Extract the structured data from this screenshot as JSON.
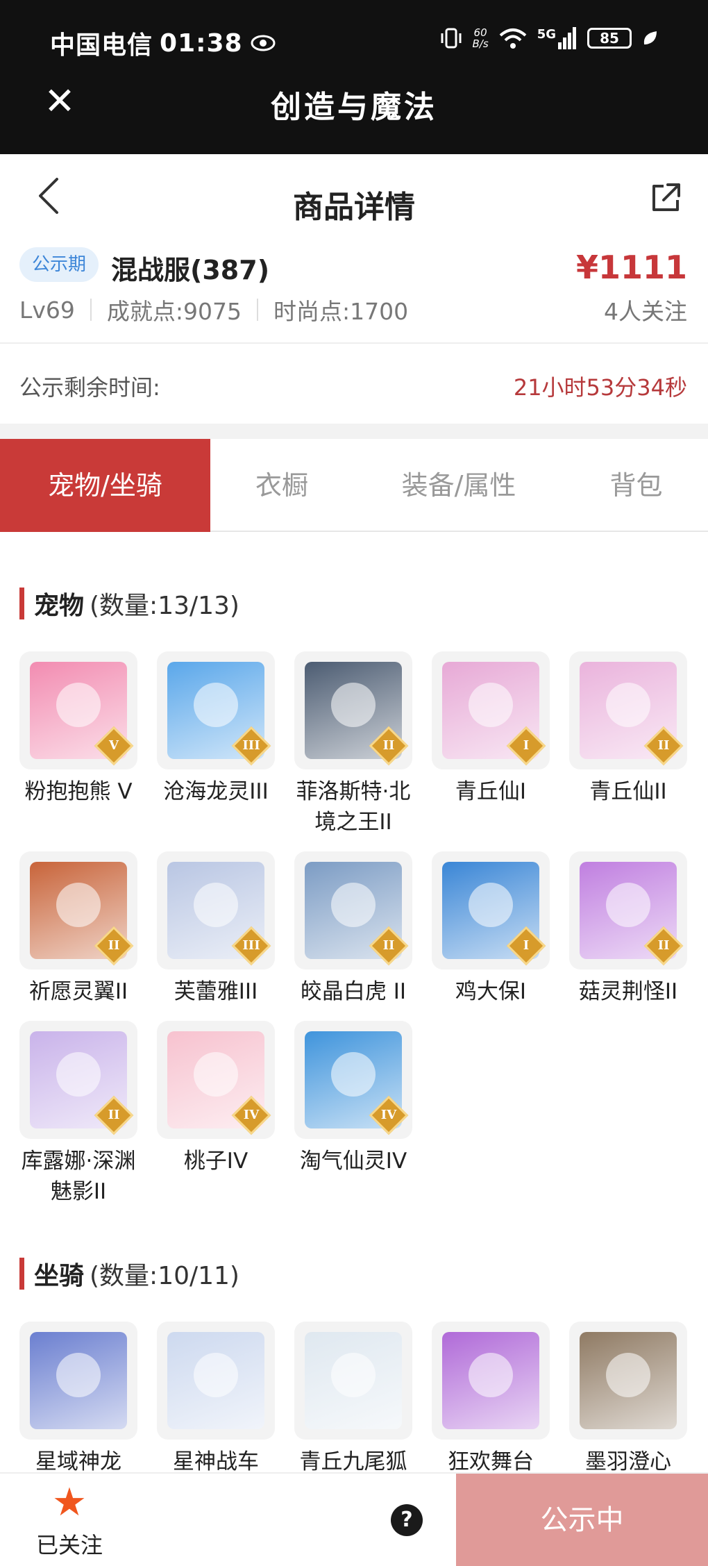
{
  "status_bar": {
    "carrier": "中国电信",
    "time": "01:38",
    "net_speed": "60",
    "net_unit": "B/s",
    "network": "5G",
    "battery": "85"
  },
  "app": {
    "title": "创造与魔法"
  },
  "page": {
    "title": "商品详情"
  },
  "item": {
    "badge": "公示期",
    "server": "混战服(387)",
    "price": "¥1111",
    "level": "Lv69",
    "achievement": "成就点:9075",
    "fashion": "时尚点:1700",
    "followers": "4人关注",
    "timer_label": "公示剩余时间:",
    "timer_value": "21小时53分34秒"
  },
  "tabs": [
    {
      "label": "宠物/坐骑",
      "active": true
    },
    {
      "label": "衣橱",
      "active": false
    },
    {
      "label": "装备/属性",
      "active": false
    },
    {
      "label": "背包",
      "active": false
    }
  ],
  "pets": {
    "title": "宠物",
    "count": "(数量:13/13)",
    "items": [
      {
        "name": "粉抱抱熊 V",
        "tier": "V",
        "color": "#f28cb1"
      },
      {
        "name": "沧海龙灵III",
        "tier": "III",
        "color": "#5aa7ea"
      },
      {
        "name": "菲洛斯特·北境之王II",
        "tier": "II",
        "color": "#4c5c72"
      },
      {
        "name": "青丘仙I",
        "tier": "I",
        "color": "#e7a9d6"
      },
      {
        "name": "青丘仙II",
        "tier": "II",
        "color": "#eab3dc"
      },
      {
        "name": "祈愿灵翼II",
        "tier": "II",
        "color": "#c8643a"
      },
      {
        "name": "芙蕾雅III",
        "tier": "III",
        "color": "#b9c6e3"
      },
      {
        "name": "皎晶白虎 II",
        "tier": "II",
        "color": "#7c9cc4"
      },
      {
        "name": "鸡大保I",
        "tier": "I",
        "color": "#3a86d6"
      },
      {
        "name": "菇灵荆怪II",
        "tier": "II",
        "color": "#c07fe0"
      },
      {
        "name": "库露娜·深渊魅影II",
        "tier": "II",
        "color": "#c9b3ea"
      },
      {
        "name": "桃子IV",
        "tier": "IV",
        "color": "#f7c2cf"
      },
      {
        "name": "淘气仙灵IV",
        "tier": "IV",
        "color": "#3f94dc"
      }
    ]
  },
  "mounts": {
    "title": "坐骑",
    "count": "(数量:10/11)",
    "items": [
      {
        "name": "星域神龙",
        "color": "#6b7fd0"
      },
      {
        "name": "星神战车",
        "color": "#cdd9ef"
      },
      {
        "name": "青丘九尾狐",
        "color": "#dfe8f0"
      },
      {
        "name": "狂欢舞台",
        "color": "#b06ad8"
      },
      {
        "name": "墨羽澄心",
        "color": "#8f7a63"
      }
    ]
  },
  "bottom": {
    "fav_label": "已关注",
    "help": "?",
    "status_label": "公示中"
  }
}
